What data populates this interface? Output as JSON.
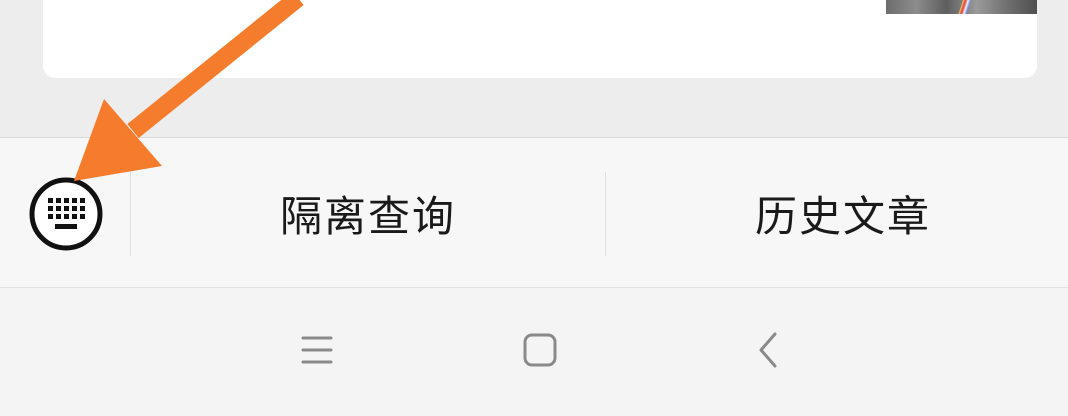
{
  "menu": {
    "items": [
      {
        "label": "隔离查询"
      },
      {
        "label": "历史文章"
      }
    ]
  },
  "icons": {
    "keyboard": "keyboard-icon",
    "nav_menu": "hamburger-icon",
    "nav_home": "square-icon",
    "nav_back": "chevron-left-icon",
    "annotation": "arrow-icon"
  },
  "colors": {
    "arrow": "#f47c2c",
    "text": "#1a1a1a",
    "nav_icon": "#8a8a8a"
  }
}
